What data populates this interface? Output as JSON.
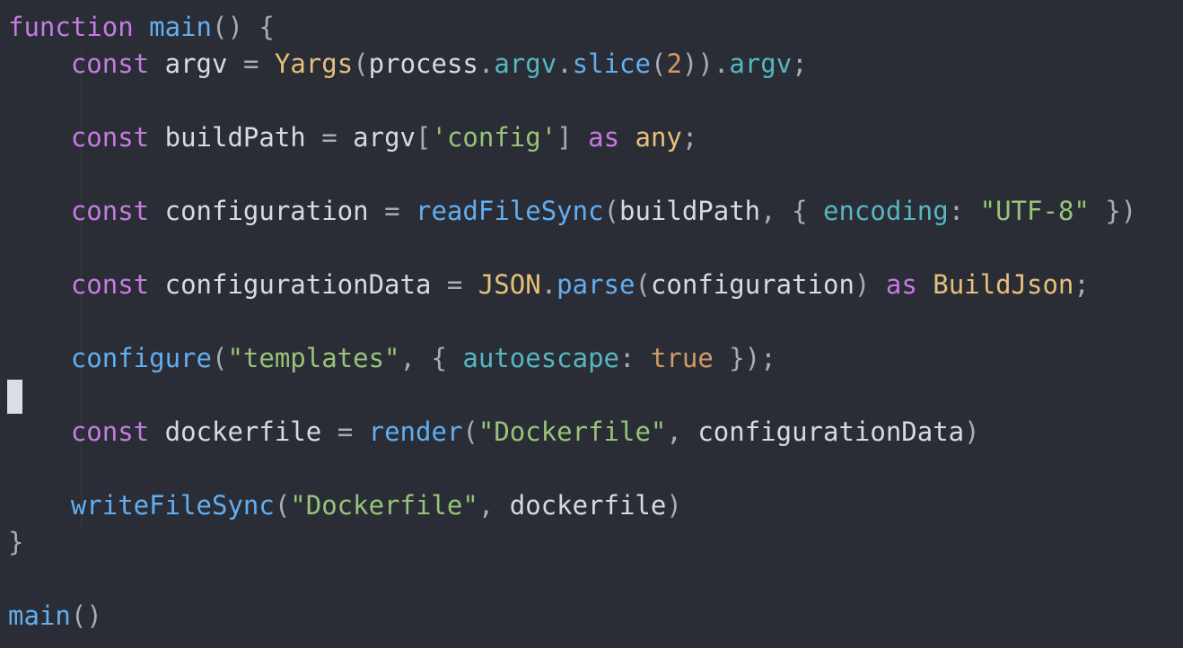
{
  "editor": {
    "lines": [
      "function main() {",
      "    const argv = Yargs(process.argv.slice(2)).argv;",
      "",
      "    const buildPath = argv['config'] as any;",
      "",
      "    const configuration = readFileSync(buildPath, { encoding: \"UTF-8\" })",
      "",
      "    const configurationData = JSON.parse(configuration) as BuildJson;",
      "",
      "    configure(\"templates\", { autoescape: true });",
      "",
      "    const dockerfile = render(\"Dockerfile\", configurationData)",
      "",
      "    writeFileSync(\"Dockerfile\", dockerfile)",
      "}",
      "",
      "main()"
    ]
  },
  "colors": {
    "background": "#2a2d35",
    "keyword": "#c57be0",
    "function": "#62aef0",
    "string": "#98c379",
    "number": "#d19a66",
    "class": "#e5c07b",
    "property": "#56b6c2"
  }
}
